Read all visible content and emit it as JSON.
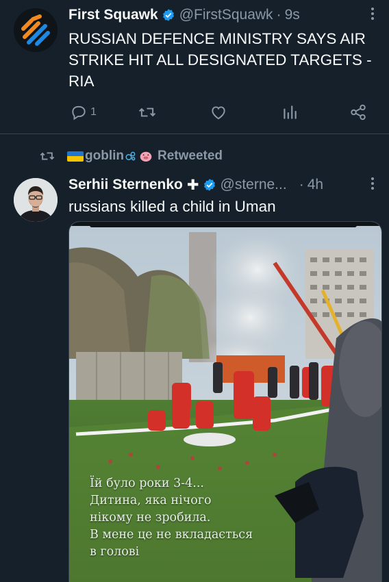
{
  "tweet1": {
    "avatar_icon": "first-squawk-logo",
    "name": "First Squawk",
    "handle": "@FirstSquawk",
    "separator": "·",
    "time": "9s",
    "text_lines": [
      "RUSSIAN DEFENCE MINISTRY SAYS AIR",
      "STRIKE HIT ALL DESIGNATED TARGETS -",
      "RIA"
    ],
    "actions": {
      "reply_count": "1",
      "retweet_icon": "retweet-icon",
      "like_icon": "heart-icon",
      "views_icon": "analytics-icon",
      "share_icon": "share-icon"
    }
  },
  "tweet2": {
    "retweeted_by": "goblin",
    "retweeted_label": "Retweeted",
    "name": "Serhii Sternenko",
    "name_symbol": "✚",
    "handle": "@sterne...",
    "separator": "·",
    "time": "4h",
    "text": "russians killed a child in Uman",
    "media": {
      "caption_lines": [
        "Їй було роки 3-4...",
        "Дитина, яка нічого",
        "нікому не зробила.",
        "В мене це не вкладається",
        "в голові"
      ]
    }
  },
  "colors": {
    "background": "#15202b",
    "verified_blue": "#1d9bf0",
    "secondary_text": "#8b98a5",
    "divider": "#38444d"
  }
}
